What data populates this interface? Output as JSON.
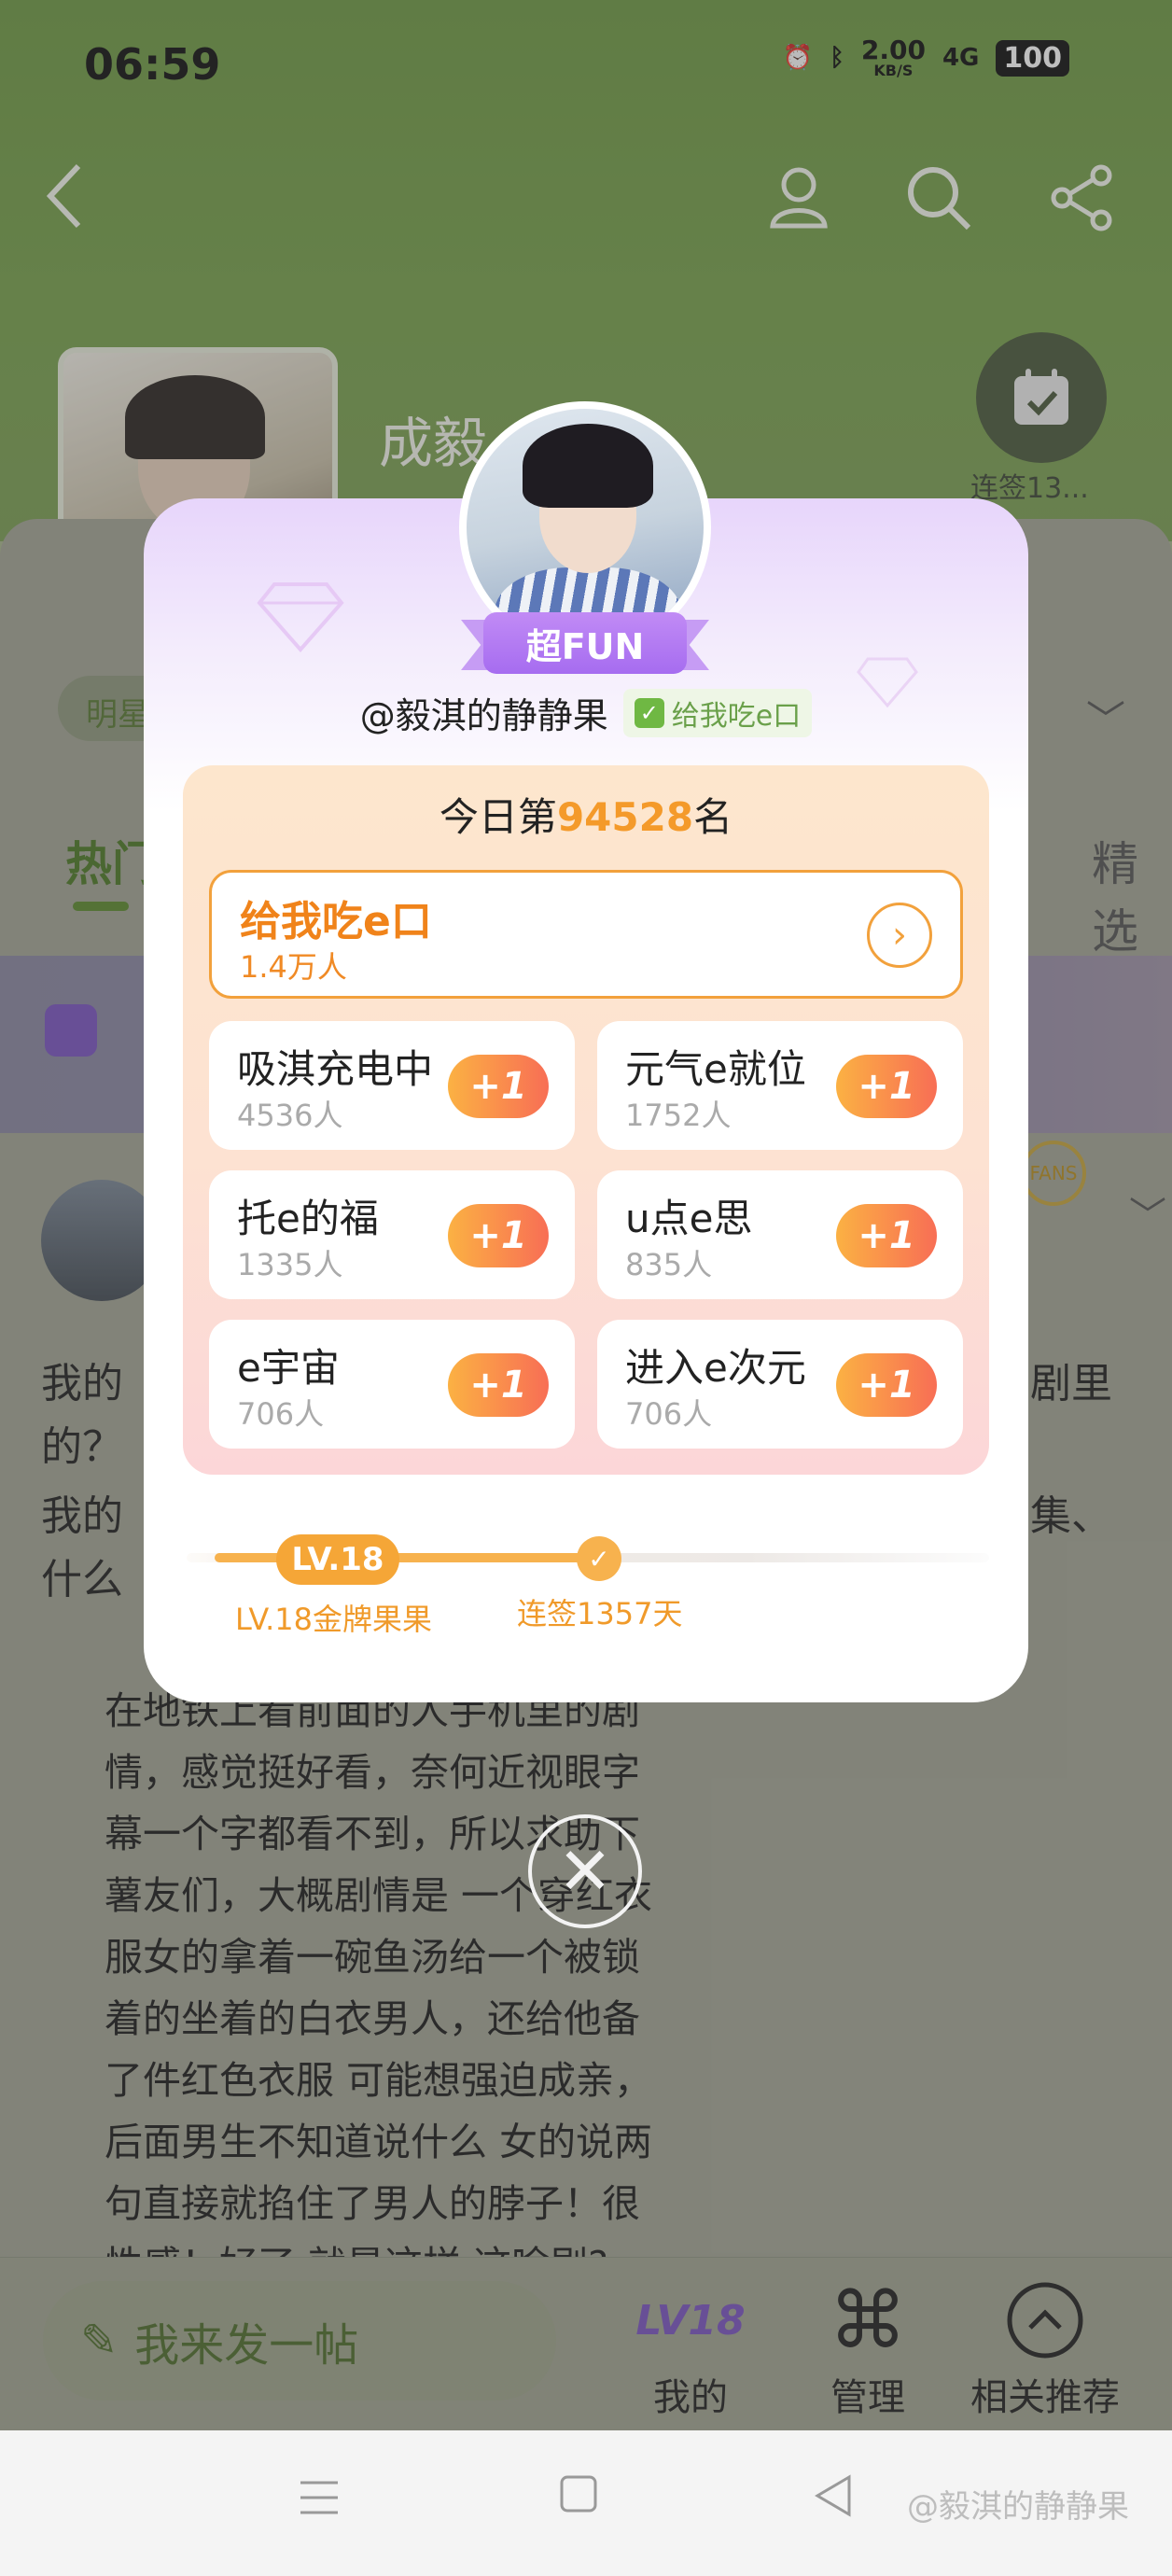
{
  "status_bar": {
    "time": "06:59",
    "net_speed": "2.00",
    "net_unit": "KB/S",
    "signal": "4G",
    "battery": "100"
  },
  "header": {
    "group_name": "成毅",
    "checkin_label": "连签13..."
  },
  "background": {
    "chip": "明星",
    "tab_hot": "热门",
    "tab_pick": "精选",
    "fans_badge": "FANS",
    "post_lines": [
      "我的",
      "剧里",
      "的？",
      "我的",
      "集、",
      "什么"
    ],
    "quote_lines": [
      "在地铁上看前面的人手机里的剧",
      "情，感觉挺好看，奈何近视眼字",
      "幕一个字都看不到，所以求助下",
      "薯友们，大概剧情是 一个穿红衣",
      "服女的拿着一碗鱼汤给一个被锁",
      "着的坐着的白衣男人，还给他备",
      "了件红色衣服 可能想强迫成亲，",
      "后面男生不知道说什么 女的说两",
      "句直接就掐住了男人的脖子！很",
      "性感！好了 就是这样 这啥剧?"
    ]
  },
  "bottom_bar": {
    "compose": "我来发一帖",
    "mine_level": "LV18",
    "mine": "我的",
    "manage": "管理",
    "recommend": "相关推荐"
  },
  "watermark": "@毅淇的静静果",
  "modal": {
    "badge": "超FUN",
    "handle": "@毅淇的静静果",
    "group_tag": "给我吃e口",
    "rank_prefix": "今日第",
    "rank_number": "94528",
    "rank_suffix": "名",
    "main_group": {
      "name": "给我吃e口",
      "count": "1.4万人"
    },
    "groups": [
      {
        "name": "吸淇充电中",
        "count": "4536人",
        "action": "+1"
      },
      {
        "name": "元气e就位",
        "count": "1752人",
        "action": "+1"
      },
      {
        "name": "托e的福",
        "count": "1335人",
        "action": "+1"
      },
      {
        "name": "u点e思",
        "count": "835人",
        "action": "+1"
      },
      {
        "name": "e宇宙",
        "count": "706人",
        "action": "+1"
      },
      {
        "name": "进入e次元",
        "count": "706人",
        "action": "+1"
      }
    ],
    "level_pill": "LV.18",
    "level_label": "LV.18金牌果果",
    "signin_label": "连签1357天",
    "colors": {
      "accent": "#f49a2a",
      "badge": "#a66cf0",
      "plus": "#f86e55"
    }
  }
}
